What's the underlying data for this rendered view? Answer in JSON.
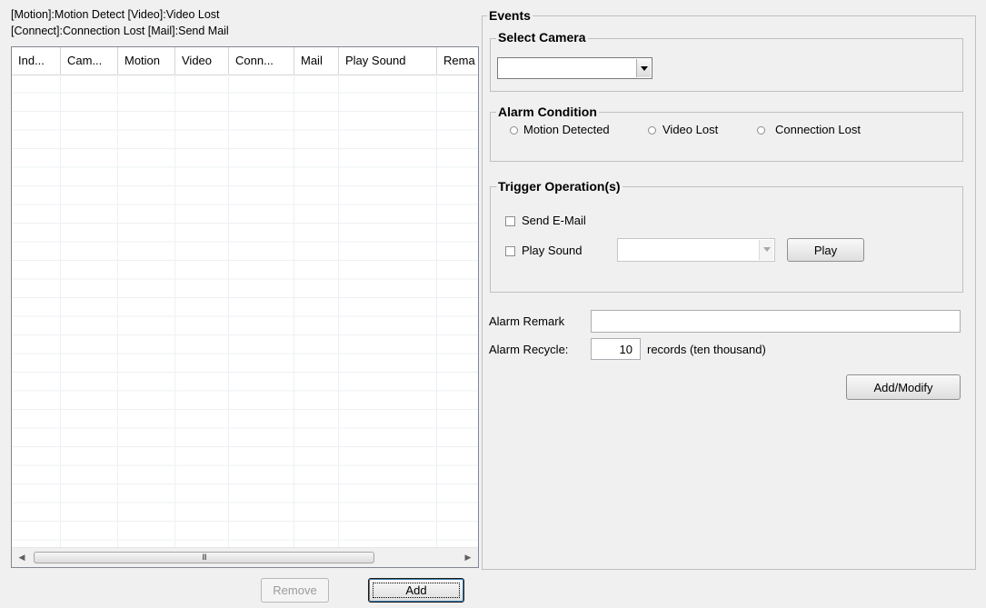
{
  "legend": {
    "line1": "[Motion]:Motion Detect  [Video]:Video Lost",
    "line2": "[Connect]:Connection Lost [Mail]:Send Mail"
  },
  "list": {
    "columns": [
      "Ind...",
      "Cam...",
      "Motion",
      "Video",
      "Conn...",
      "Mail",
      "Play Sound",
      "Rema"
    ],
    "rows": [],
    "scrollbar": {
      "grip": "III",
      "left_arrow": "◀",
      "right_arrow": "▶"
    }
  },
  "buttons": {
    "remove": "Remove",
    "add": "Add",
    "play": "Play",
    "add_modify": "Add/Modify"
  },
  "events": {
    "title": "Events",
    "select_camera": {
      "title": "Select Camera",
      "value": ""
    },
    "alarm_condition": {
      "title": "Alarm Condition",
      "options": [
        "Motion Detected",
        "Video Lost",
        "Connection Lost"
      ]
    },
    "trigger": {
      "title": "Trigger Operation(s)",
      "send_email": "Send E-Mail",
      "play_sound": "Play Sound",
      "sound_value": ""
    },
    "alarm_remark": {
      "label": "Alarm Remark",
      "value": ""
    },
    "alarm_recycle": {
      "label": "Alarm Recycle:",
      "value": "10",
      "suffix": "records (ten thousand)"
    }
  }
}
